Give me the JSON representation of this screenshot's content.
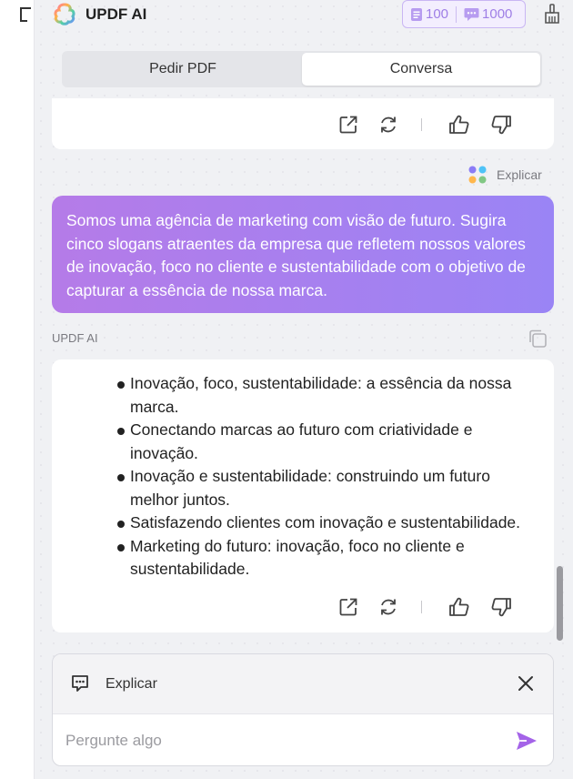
{
  "app": {
    "title": "UPDF AI"
  },
  "credits": {
    "pdf_credits": "100",
    "chat_credits": "1000"
  },
  "tabs": [
    {
      "label": "Pedir PDF",
      "active": false
    },
    {
      "label": "Conversa",
      "active": true
    }
  ],
  "explain_tag": {
    "label": "Explicar"
  },
  "user_message": {
    "text": "Somos uma agência de marketing com visão de futuro. Sugira cinco slogans atraentes da empresa que refletem nossos valores de inovação, foco no cliente e sustentabilidade com o objetivo de capturar a essência de nossa marca."
  },
  "ai_label": "UPDF AI",
  "ai_answer": {
    "items": [
      "Inovação, foco, sustentabilidade: a essência da nossa marca.",
      "Conectando marcas ao futuro com criatividade e inovação.",
      "Inovação e sustentabilidade: construindo um futuro melhor juntos.",
      "Satisfazendo clientes com inovação e sustentabilidade.",
      "Marketing do futuro: inovação, foco no cliente e sustentabilidade."
    ]
  },
  "composer": {
    "quote_label": "Explicar",
    "placeholder": "Pergunte algo",
    "value": ""
  },
  "colors": {
    "accent": "#9a84f5",
    "bubble_start": "#b57be8",
    "send": "#a463e8"
  },
  "icons": [
    "share-icon",
    "regenerate-icon",
    "thumbs-up-icon",
    "thumbs-down-icon",
    "copy-icon",
    "close-icon",
    "send-icon",
    "broom-icon",
    "logo-icon"
  ]
}
